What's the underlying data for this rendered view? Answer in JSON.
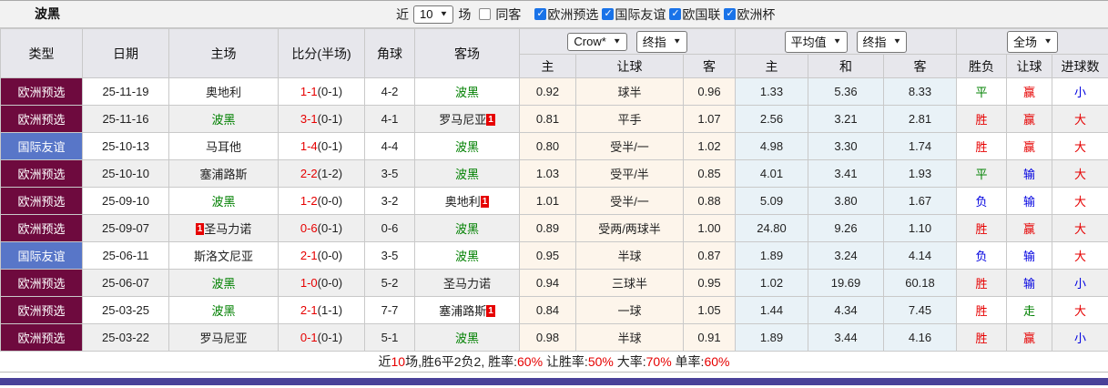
{
  "topbar": {
    "team": "波黑",
    "recent_label": "近",
    "match_count": "10",
    "matches_label": "场",
    "same_away_label": "同客",
    "same_away_checked": false,
    "filters": [
      {
        "label": "欧洲预选",
        "checked": true
      },
      {
        "label": "国际友谊",
        "checked": true
      },
      {
        "label": "欧国联",
        "checked": true
      },
      {
        "label": "欧洲杯",
        "checked": true
      }
    ]
  },
  "table": {
    "main_headers": [
      "类型",
      "日期",
      "主场",
      "比分(半场)",
      "角球",
      "客场"
    ],
    "sub_headers": [
      "主",
      "让球",
      "客",
      "主",
      "和",
      "客",
      "胜负",
      "让球",
      "进球数"
    ],
    "selects": {
      "bookmaker": "Crow*",
      "bookmaker_time": "终指",
      "europe": "平均值",
      "europe_time": "终指",
      "scope": "全场"
    },
    "rows": [
      {
        "type": "欧洲预选",
        "type_class": "maroon",
        "date": "25-11-19",
        "home": "奥地利",
        "home_green": false,
        "home_badge": "",
        "home_badge_pos": "",
        "score": "1-1",
        "half": "(0-1)",
        "corner": "4-2",
        "away": "波黑",
        "away_green": true,
        "away_badge": "",
        "away_badge_pos": "",
        "crow_home": "0.92",
        "handicap": "球半",
        "crow_away": "0.96",
        "euro_home": "1.33",
        "euro_draw": "5.36",
        "euro_away": "8.33",
        "result": "平",
        "result_color": "green",
        "let_result": "赢",
        "let_color": "red",
        "goals": "小",
        "goals_color": "blue"
      },
      {
        "type": "欧洲预选",
        "type_class": "maroon",
        "date": "25-11-16",
        "home": "波黑",
        "home_green": true,
        "home_badge": "",
        "home_badge_pos": "",
        "score": "3-1",
        "half": "(0-1)",
        "corner": "4-1",
        "away": "罗马尼亚",
        "away_green": false,
        "away_badge": "1",
        "away_badge_pos": "after",
        "crow_home": "0.81",
        "handicap": "平手",
        "crow_away": "1.07",
        "euro_home": "2.56",
        "euro_draw": "3.21",
        "euro_away": "2.81",
        "result": "胜",
        "result_color": "red",
        "let_result": "赢",
        "let_color": "red",
        "goals": "大",
        "goals_color": "red"
      },
      {
        "type": "国际友谊",
        "type_class": "blue",
        "date": "25-10-13",
        "home": "马耳他",
        "home_green": false,
        "home_badge": "",
        "home_badge_pos": "",
        "score": "1-4",
        "half": "(0-1)",
        "corner": "4-4",
        "away": "波黑",
        "away_green": true,
        "away_badge": "",
        "away_badge_pos": "",
        "crow_home": "0.80",
        "handicap": "受半/一",
        "crow_away": "1.02",
        "euro_home": "4.98",
        "euro_draw": "3.30",
        "euro_away": "1.74",
        "result": "胜",
        "result_color": "red",
        "let_result": "赢",
        "let_color": "red",
        "goals": "大",
        "goals_color": "red"
      },
      {
        "type": "欧洲预选",
        "type_class": "maroon",
        "date": "25-10-10",
        "home": "塞浦路斯",
        "home_green": false,
        "home_badge": "",
        "home_badge_pos": "",
        "score": "2-2",
        "half": "(1-2)",
        "corner": "3-5",
        "away": "波黑",
        "away_green": true,
        "away_badge": "",
        "away_badge_pos": "",
        "crow_home": "1.03",
        "handicap": "受平/半",
        "crow_away": "0.85",
        "euro_home": "4.01",
        "euro_draw": "3.41",
        "euro_away": "1.93",
        "result": "平",
        "result_color": "green",
        "let_result": "输",
        "let_color": "blue",
        "goals": "大",
        "goals_color": "red"
      },
      {
        "type": "欧洲预选",
        "type_class": "maroon",
        "date": "25-09-10",
        "home": "波黑",
        "home_green": true,
        "home_badge": "",
        "home_badge_pos": "",
        "score": "1-2",
        "half": "(0-0)",
        "corner": "3-2",
        "away": "奥地利",
        "away_green": false,
        "away_badge": "1",
        "away_badge_pos": "after",
        "crow_home": "1.01",
        "handicap": "受半/一",
        "crow_away": "0.88",
        "euro_home": "5.09",
        "euro_draw": "3.80",
        "euro_away": "1.67",
        "result": "负",
        "result_color": "blue",
        "let_result": "输",
        "let_color": "blue",
        "goals": "大",
        "goals_color": "red"
      },
      {
        "type": "欧洲预选",
        "type_class": "maroon",
        "date": "25-09-07",
        "home": "圣马力诺",
        "home_green": false,
        "home_badge": "1",
        "home_badge_pos": "before",
        "score": "0-6",
        "half": "(0-1)",
        "corner": "0-6",
        "away": "波黑",
        "away_green": true,
        "away_badge": "",
        "away_badge_pos": "",
        "crow_home": "0.89",
        "handicap": "受两/两球半",
        "crow_away": "1.00",
        "euro_home": "24.80",
        "euro_draw": "9.26",
        "euro_away": "1.10",
        "result": "胜",
        "result_color": "red",
        "let_result": "赢",
        "let_color": "red",
        "goals": "大",
        "goals_color": "red"
      },
      {
        "type": "国际友谊",
        "type_class": "blue",
        "date": "25-06-11",
        "home": "斯洛文尼亚",
        "home_green": false,
        "home_badge": "",
        "home_badge_pos": "",
        "score": "2-1",
        "half": "(0-0)",
        "corner": "3-5",
        "away": "波黑",
        "away_green": true,
        "away_badge": "",
        "away_badge_pos": "",
        "crow_home": "0.95",
        "handicap": "半球",
        "crow_away": "0.87",
        "euro_home": "1.89",
        "euro_draw": "3.24",
        "euro_away": "4.14",
        "result": "负",
        "result_color": "blue",
        "let_result": "输",
        "let_color": "blue",
        "goals": "大",
        "goals_color": "red"
      },
      {
        "type": "欧洲预选",
        "type_class": "maroon",
        "date": "25-06-07",
        "home": "波黑",
        "home_green": true,
        "home_badge": "",
        "home_badge_pos": "",
        "score": "1-0",
        "half": "(0-0)",
        "corner": "5-2",
        "away": "圣马力诺",
        "away_green": false,
        "away_badge": "",
        "away_badge_pos": "",
        "crow_home": "0.94",
        "handicap": "三球半",
        "crow_away": "0.95",
        "euro_home": "1.02",
        "euro_draw": "19.69",
        "euro_away": "60.18",
        "result": "胜",
        "result_color": "red",
        "let_result": "输",
        "let_color": "blue",
        "goals": "小",
        "goals_color": "blue"
      },
      {
        "type": "欧洲预选",
        "type_class": "maroon",
        "date": "25-03-25",
        "home": "波黑",
        "home_green": true,
        "home_badge": "",
        "home_badge_pos": "",
        "score": "2-1",
        "half": "(1-1)",
        "corner": "7-7",
        "away": "塞浦路斯",
        "away_green": false,
        "away_badge": "1",
        "away_badge_pos": "after",
        "crow_home": "0.84",
        "handicap": "一球",
        "crow_away": "1.05",
        "euro_home": "1.44",
        "euro_draw": "4.34",
        "euro_away": "7.45",
        "result": "胜",
        "result_color": "red",
        "let_result": "走",
        "let_color": "green",
        "goals": "大",
        "goals_color": "red"
      },
      {
        "type": "欧洲预选",
        "type_class": "maroon",
        "date": "25-03-22",
        "home": "罗马尼亚",
        "home_green": false,
        "home_badge": "",
        "home_badge_pos": "",
        "score": "0-1",
        "half": "(0-1)",
        "corner": "5-1",
        "away": "波黑",
        "away_green": true,
        "away_badge": "",
        "away_badge_pos": "",
        "crow_home": "0.98",
        "handicap": "半球",
        "crow_away": "0.91",
        "euro_home": "1.89",
        "euro_draw": "3.44",
        "euro_away": "4.16",
        "result": "胜",
        "result_color": "red",
        "let_result": "赢",
        "let_color": "red",
        "goals": "小",
        "goals_color": "blue"
      }
    ]
  },
  "footer": {
    "segments": [
      {
        "text": "近",
        "color": "dark"
      },
      {
        "text": "10",
        "color": "red"
      },
      {
        "text": "场,胜6平2负2, 胜率:",
        "color": "dark"
      },
      {
        "text": "60%",
        "color": "red"
      },
      {
        "text": " 让胜率:",
        "color": "dark"
      },
      {
        "text": "50%",
        "color": "red"
      },
      {
        "text": " 大率:",
        "color": "dark"
      },
      {
        "text": "70%",
        "color": "red"
      },
      {
        "text": " 单率:",
        "color": "dark"
      },
      {
        "text": "60%",
        "color": "red"
      }
    ]
  },
  "colors": {
    "type_maroon": "#6e0a3e",
    "type_blue": "#5876c8",
    "text_red": "#e60000",
    "text_green": "#008000",
    "text_blue": "#0000e0",
    "cream_bg": "#fdf5eb",
    "euro_bg": "#e9f2f7",
    "bottom_bar": "#4a4199",
    "checkbox_blue": "#1a73e8"
  }
}
